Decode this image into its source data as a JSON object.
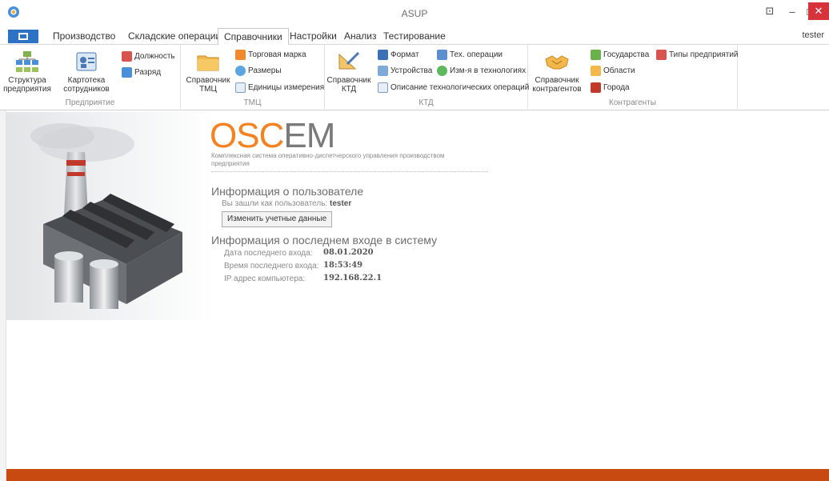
{
  "window": {
    "title": "ASUP",
    "restore": "⊡",
    "minimize": "–",
    "maximize": "□",
    "close": "✕"
  },
  "menu": {
    "tabs": [
      "Производство",
      "Складские операции",
      "Справочники",
      "Настройки",
      "Анализ",
      "Тестирование"
    ],
    "active_tab": "Справочники",
    "user": "tester"
  },
  "ribbon": {
    "groups": {
      "enterprise": {
        "label": "Предприятие",
        "structure": "Структура\nпредприятия",
        "employees": "Картотека\nсотрудников",
        "position": "Должность",
        "rank": "Разряд"
      },
      "tmc": {
        "label": "ТМЦ",
        "reference": "Справочник\nТМЦ",
        "trademark": "Торговая марка",
        "sizes": "Размеры",
        "units": "Единицы измерения"
      },
      "ktd": {
        "label": "КТД",
        "reference": "Справочник\nКТД",
        "format": "Формат",
        "devices": "Устройства",
        "tech_ops": "Тех. операции",
        "changes": "Изм-я в технологиях",
        "descriptions": "Описание технологических операций"
      },
      "counterparties": {
        "label": "Контрагенты",
        "reference": "Справочник\nконтрагентов",
        "states": "Государства",
        "enterprise_types": "Типы предприятий",
        "regions": "Области",
        "cities": "Города"
      }
    }
  },
  "main": {
    "logo_osc": "OSC",
    "logo_em": "EM",
    "tagline": "Комплексная система оперативно-диспетчерского управления производством предприятия",
    "user_info_heading": "Информация о пользователе",
    "logged_as_label": "Вы зашли как пользователь:",
    "logged_as_value": "tester",
    "change_button": "Изменить учетные данные",
    "last_login_heading": "Информация о последнем входе в систему",
    "last_login": {
      "date_label": "Дата последнего входа:",
      "date_value": "08.01.2020",
      "time_label": "Время последнего входа:",
      "time_value": "18:53:49",
      "ip_label": "IP адрес компьютера:",
      "ip_value": "192.168.22.1"
    }
  },
  "colors": {
    "accent": "#f58220",
    "status_bar": "#c94a10",
    "file_button": "#2d72c4",
    "close_button": "#d6343a"
  }
}
